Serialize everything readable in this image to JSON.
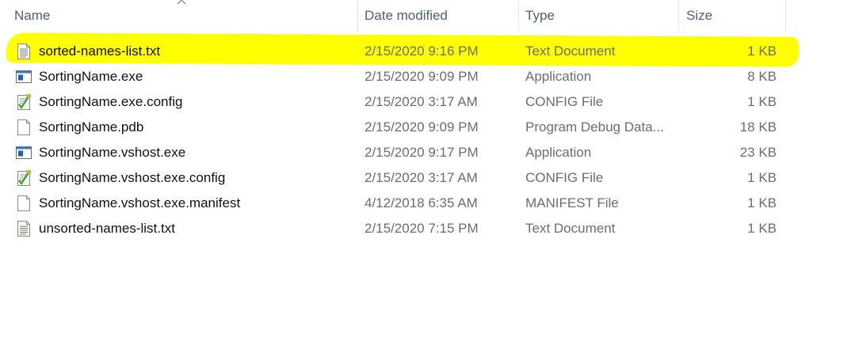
{
  "columns": {
    "name": "Name",
    "date": "Date modified",
    "type": "Type",
    "size": "Size"
  },
  "files": [
    {
      "name": "sorted-names-list.txt",
      "date": "2/15/2020 9:16 PM",
      "type": "Text Document",
      "size": "1 KB",
      "icon": "text-file-icon",
      "highlighted": true
    },
    {
      "name": "SortingName.exe",
      "date": "2/15/2020 9:09 PM",
      "type": "Application",
      "size": "8 KB",
      "icon": "application-icon",
      "highlighted": false
    },
    {
      "name": "SortingName.exe.config",
      "date": "2/15/2020 3:17 AM",
      "type": "CONFIG File",
      "size": "1 KB",
      "icon": "config-file-icon",
      "highlighted": false
    },
    {
      "name": "SortingName.pdb",
      "date": "2/15/2020 9:09 PM",
      "type": "Program Debug Data...",
      "size": "18 KB",
      "icon": "blank-file-icon",
      "highlighted": false
    },
    {
      "name": "SortingName.vshost.exe",
      "date": "2/15/2020 9:17 PM",
      "type": "Application",
      "size": "23 KB",
      "icon": "application-icon",
      "highlighted": false
    },
    {
      "name": "SortingName.vshost.exe.config",
      "date": "2/15/2020 3:17 AM",
      "type": "CONFIG File",
      "size": "1 KB",
      "icon": "config-file-icon",
      "highlighted": false
    },
    {
      "name": "SortingName.vshost.exe.manifest",
      "date": "4/12/2018 6:35 AM",
      "type": "MANIFEST File",
      "size": "1 KB",
      "icon": "blank-file-icon",
      "highlighted": false
    },
    {
      "name": "unsorted-names-list.txt",
      "date": "2/15/2020 7:15 PM",
      "type": "Text Document",
      "size": "1 KB",
      "icon": "text-file-icon",
      "highlighted": false
    }
  ],
  "colors": {
    "highlight": "#ffff00",
    "header_text": "#4c607a",
    "secondary_text": "#6d6d6d"
  }
}
